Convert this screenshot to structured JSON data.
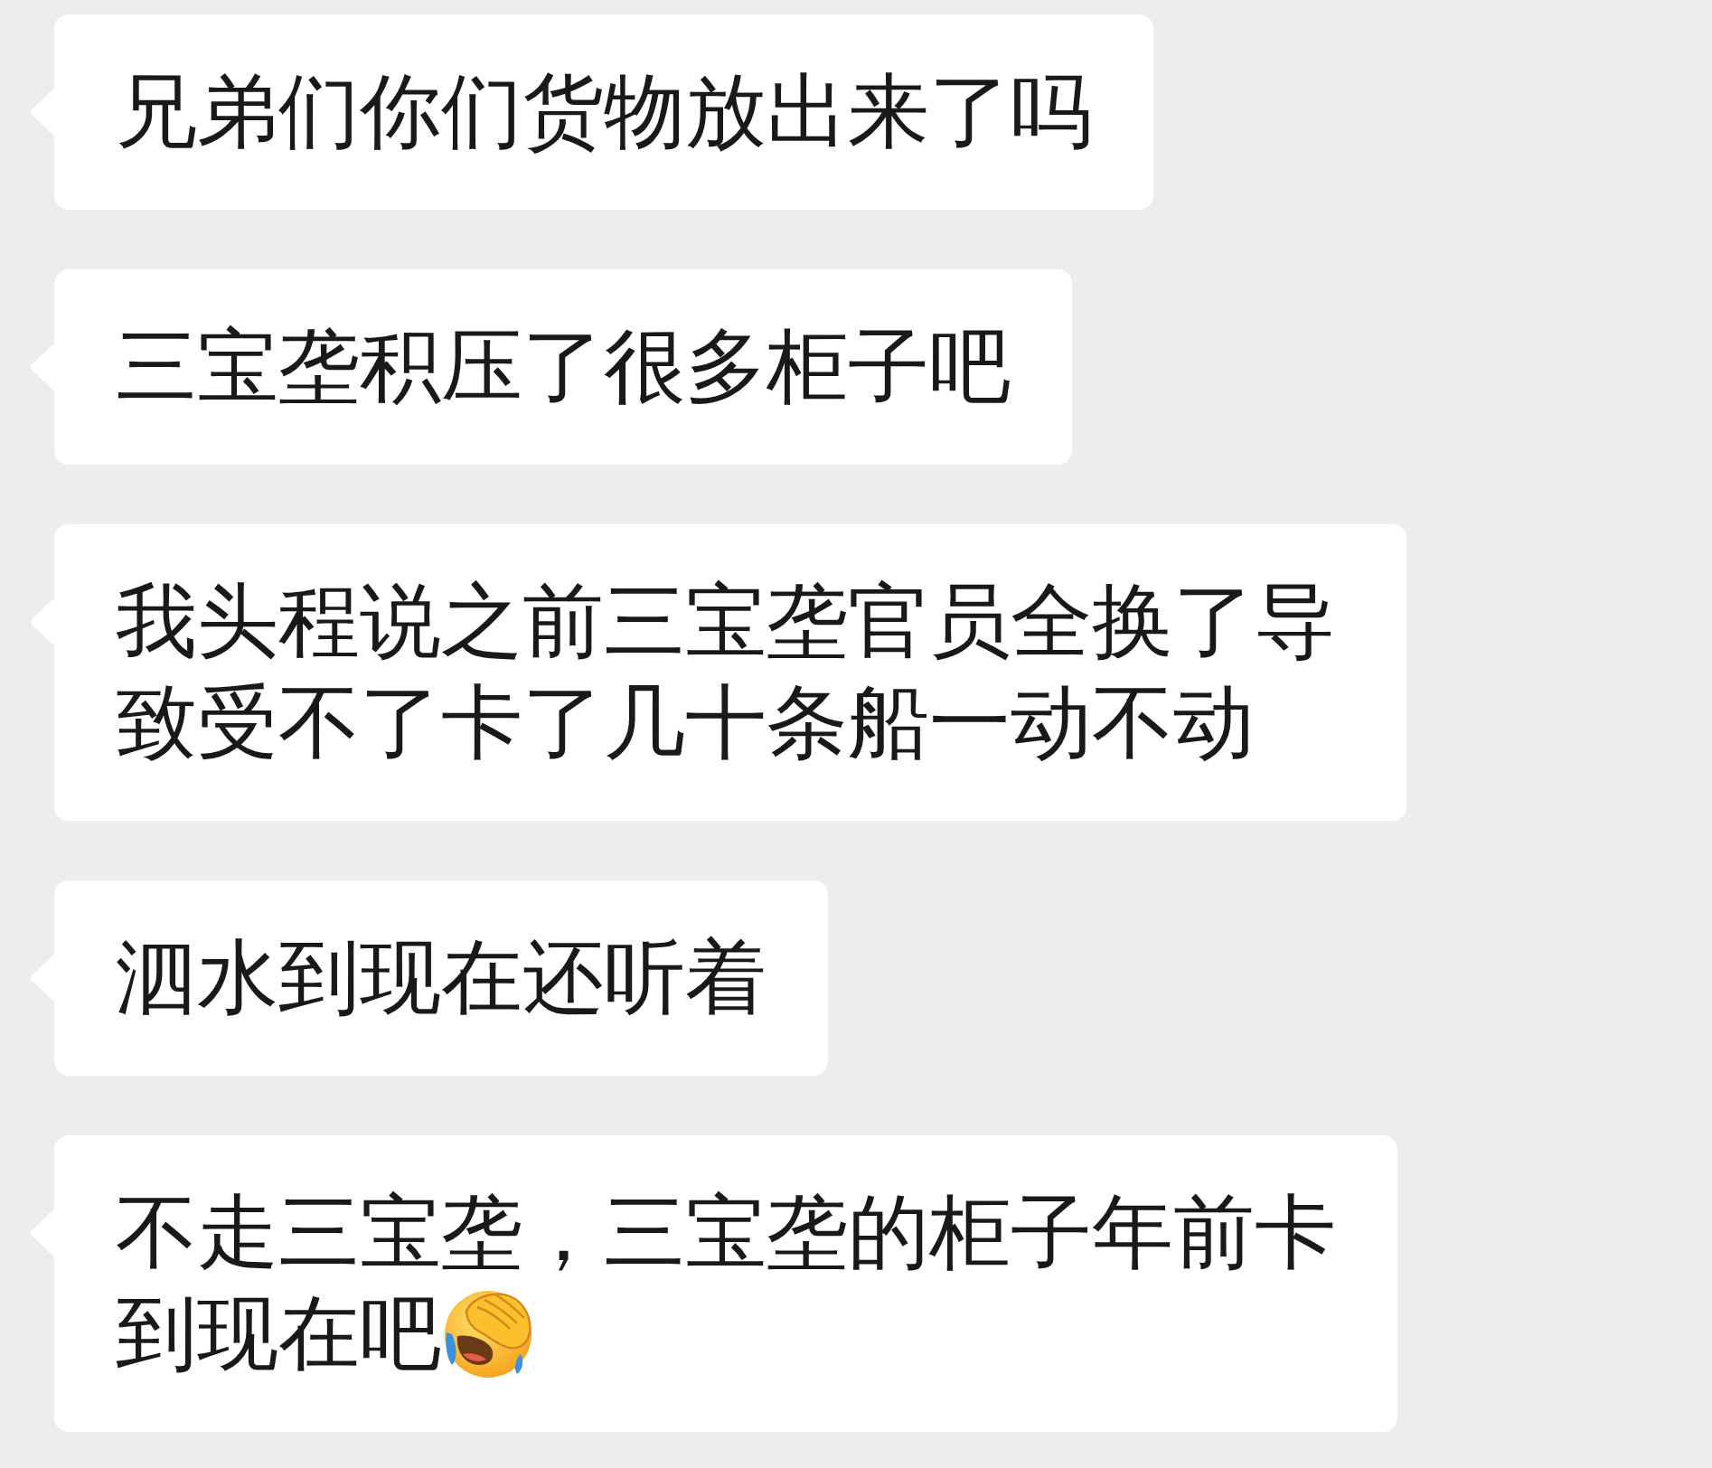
{
  "messages": [
    {
      "kind": "text",
      "text": "兄弟们你们货物放出来了吗"
    },
    {
      "kind": "text",
      "text": "三宝垄积压了很多柜子吧"
    },
    {
      "kind": "text",
      "text": "我头程说之前三宝垄官员全换了导致受不了卡了几十条船一动不动"
    },
    {
      "kind": "text",
      "text": "泗水到现在还听着"
    },
    {
      "kind": "lines_with_emoji",
      "lines": [
        "不走三宝垄，三宝垄的柜子年前卡",
        "到现在吧"
      ]
    }
  ]
}
